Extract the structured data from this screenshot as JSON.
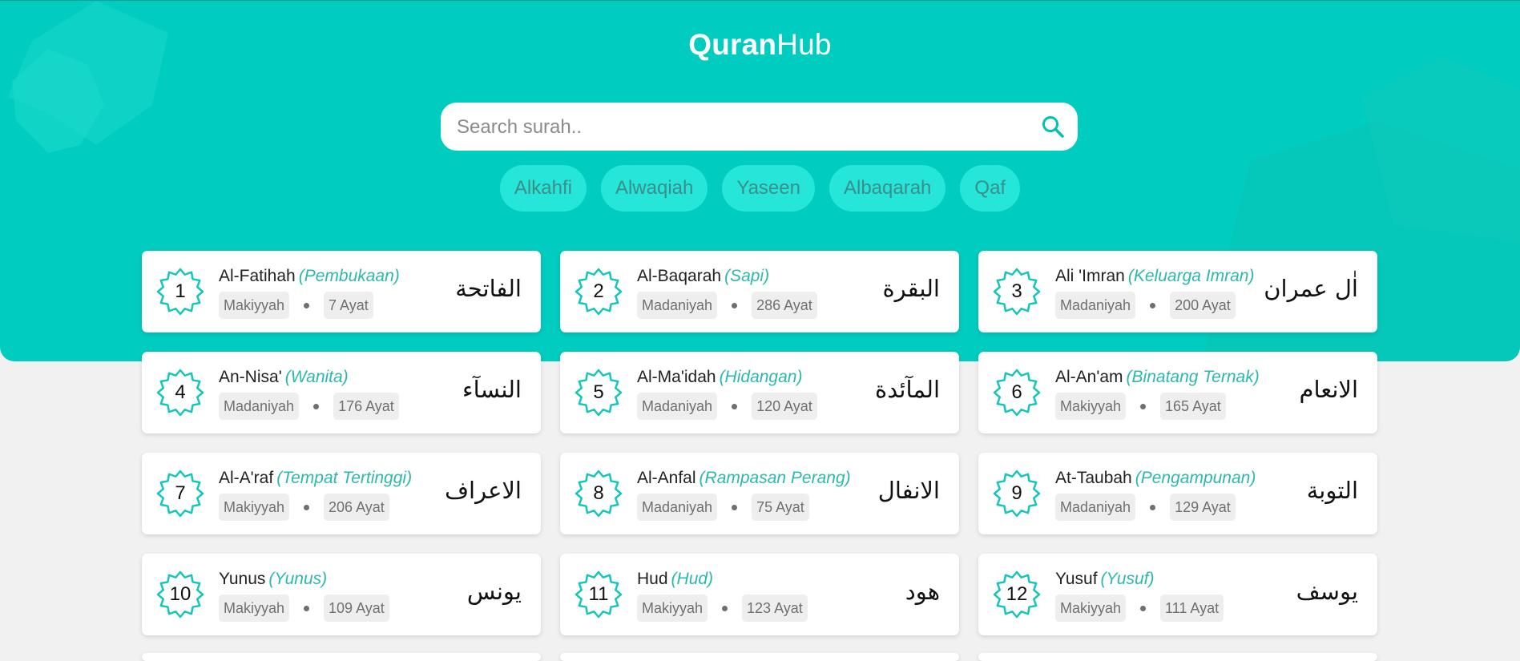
{
  "brand": {
    "strong": "Quran",
    "light": "Hub"
  },
  "search": {
    "placeholder": "Search surah..",
    "value": ""
  },
  "icons": {
    "search": "search-icon",
    "badge": "star-octagon-icon"
  },
  "colors": {
    "primary": "#00ccbf",
    "chip_bg": "#26e5d9",
    "translation": "#2cb8ae"
  },
  "chips": [
    "Alkahfi",
    "Alwaqiah",
    "Yaseen",
    "Albaqarah",
    "Qaf"
  ],
  "surahs": [
    {
      "number": "1",
      "name": "Al-Fatihah",
      "translation": "(Pembukaan)",
      "place": "Makiyyah",
      "verses": "7 Ayat",
      "arabic": "الفاتحة"
    },
    {
      "number": "2",
      "name": "Al-Baqarah",
      "translation": "(Sapi)",
      "place": "Madaniyah",
      "verses": "286 Ayat",
      "arabic": "البقرة"
    },
    {
      "number": "3",
      "name": "Ali 'Imran",
      "translation": "(Keluarga Imran)",
      "place": "Madaniyah",
      "verses": "200 Ayat",
      "arabic": "اٰل عمران"
    },
    {
      "number": "4",
      "name": "An-Nisa'",
      "translation": "(Wanita)",
      "place": "Madaniyah",
      "verses": "176 Ayat",
      "arabic": "النسآء"
    },
    {
      "number": "5",
      "name": "Al-Ma'idah",
      "translation": "(Hidangan)",
      "place": "Madaniyah",
      "verses": "120 Ayat",
      "arabic": "المآئدة"
    },
    {
      "number": "6",
      "name": "Al-An'am",
      "translation": "(Binatang Ternak)",
      "place": "Makiyyah",
      "verses": "165 Ayat",
      "arabic": "الانعام"
    },
    {
      "number": "7",
      "name": "Al-A'raf",
      "translation": "(Tempat Tertinggi)",
      "place": "Makiyyah",
      "verses": "206 Ayat",
      "arabic": "الاعراف"
    },
    {
      "number": "8",
      "name": "Al-Anfal",
      "translation": "(Rampasan Perang)",
      "place": "Madaniyah",
      "verses": "75 Ayat",
      "arabic": "الانفال"
    },
    {
      "number": "9",
      "name": "At-Taubah",
      "translation": "(Pengampunan)",
      "place": "Madaniyah",
      "verses": "129 Ayat",
      "arabic": "التوبة"
    },
    {
      "number": "10",
      "name": "Yunus",
      "translation": "(Yunus)",
      "place": "Makiyyah",
      "verses": "109 Ayat",
      "arabic": "يونس"
    },
    {
      "number": "11",
      "name": "Hud",
      "translation": "(Hud)",
      "place": "Makiyyah",
      "verses": "123 Ayat",
      "arabic": "هود"
    },
    {
      "number": "12",
      "name": "Yusuf",
      "translation": "(Yusuf)",
      "place": "Makiyyah",
      "verses": "111 Ayat",
      "arabic": "يوسف"
    }
  ]
}
